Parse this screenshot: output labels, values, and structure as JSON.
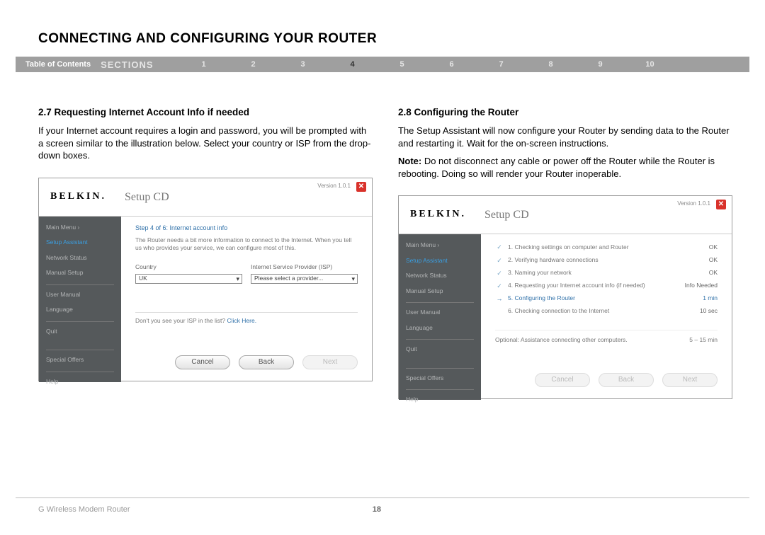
{
  "page_title": "CONNECTING AND CONFIGURING YOUR ROUTER",
  "nav": {
    "toc": "Table of Contents",
    "sections_label": "SECTIONS",
    "items": [
      "1",
      "2",
      "3",
      "4",
      "5",
      "6",
      "7",
      "8",
      "9",
      "10"
    ],
    "active_index": 3
  },
  "left_column": {
    "title": "2.7 Requesting Internet Account Info if needed",
    "para": "If your Internet account requires a login and password, you will be prompted with a screen similar to the illustration below. Select your country or ISP from the drop-down boxes."
  },
  "right_column": {
    "title": "2.8 Configuring the Router",
    "para": "The Setup Assistant will now configure your Router by sending data to the Router and restarting it. Wait for the on-screen instructions.",
    "note_label": "Note:",
    "note_text": " Do not disconnect any cable or power off the Router while the Router is rebooting. Doing so will render your Router inoperable."
  },
  "screenshot_common": {
    "logo": "BELKIN.",
    "app_title": "Setup CD",
    "version": "Version 1.0.1",
    "close_glyph": "✕",
    "sidebar": {
      "main_menu": "Main Menu  ›",
      "setup_assistant": "Setup Assistant",
      "network_status": "Network Status",
      "manual_setup": "Manual Setup",
      "user_manual": "User Manual",
      "language": "Language",
      "quit": "Quit",
      "special_offers": "Special Offers",
      "help": "Help"
    },
    "buttons": {
      "cancel": "Cancel",
      "back": "Back",
      "next": "Next"
    }
  },
  "screenshot_left": {
    "step_title": "Step 4 of 6: Internet account info",
    "desc": "The Router needs a bit more information to connect to the Internet. When you tell us who provides your service, we can configure most of this.",
    "country_label": "Country",
    "country_value": "UK",
    "isp_label": "Internet Service Provider (ISP)",
    "isp_value": "Please select a provider...",
    "isp_note_prefix": "Don't you see your ISP in the list? ",
    "isp_note_link": "Click Here."
  },
  "screenshot_right": {
    "steps": [
      {
        "icon": "✓",
        "text": "1. Checking settings on computer and Router",
        "status": "OK",
        "current": false
      },
      {
        "icon": "✓",
        "text": "2. Verifying hardware connections",
        "status": "OK",
        "current": false
      },
      {
        "icon": "✓",
        "text": "3. Naming your network",
        "status": "OK",
        "current": false
      },
      {
        "icon": "✓",
        "text": "4. Requesting your Internet account info (if needed)",
        "status": "Info Needed",
        "current": false
      },
      {
        "icon": "→",
        "text": "5. Configuring the Router",
        "status": "1 min",
        "current": true
      },
      {
        "icon": "",
        "text": "6. Checking connection to the Internet",
        "status": "10 sec",
        "current": false
      }
    ],
    "optional": {
      "text": "Optional: Assistance connecting other computers.",
      "status": "5 – 15 min"
    }
  },
  "footer": {
    "product": "G Wireless Modem Router",
    "page_number": "18"
  }
}
